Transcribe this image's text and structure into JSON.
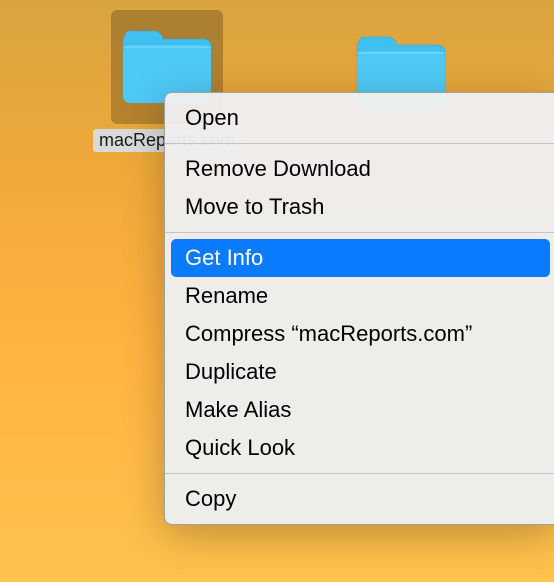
{
  "desktop": {
    "folders": [
      {
        "label": "macReports.com",
        "selected": true
      },
      {
        "label": "",
        "selected": false
      }
    ]
  },
  "context_menu": {
    "groups": [
      [
        {
          "label": "Open",
          "highlighted": false
        }
      ],
      [
        {
          "label": "Remove Download",
          "highlighted": false
        },
        {
          "label": "Move to Trash",
          "highlighted": false
        }
      ],
      [
        {
          "label": "Get Info",
          "highlighted": true
        },
        {
          "label": "Rename",
          "highlighted": false
        },
        {
          "label": "Compress “macReports.com”",
          "highlighted": false
        },
        {
          "label": "Duplicate",
          "highlighted": false
        },
        {
          "label": "Make Alias",
          "highlighted": false
        },
        {
          "label": "Quick Look",
          "highlighted": false
        }
      ],
      [
        {
          "label": "Copy",
          "highlighted": false
        }
      ]
    ]
  }
}
